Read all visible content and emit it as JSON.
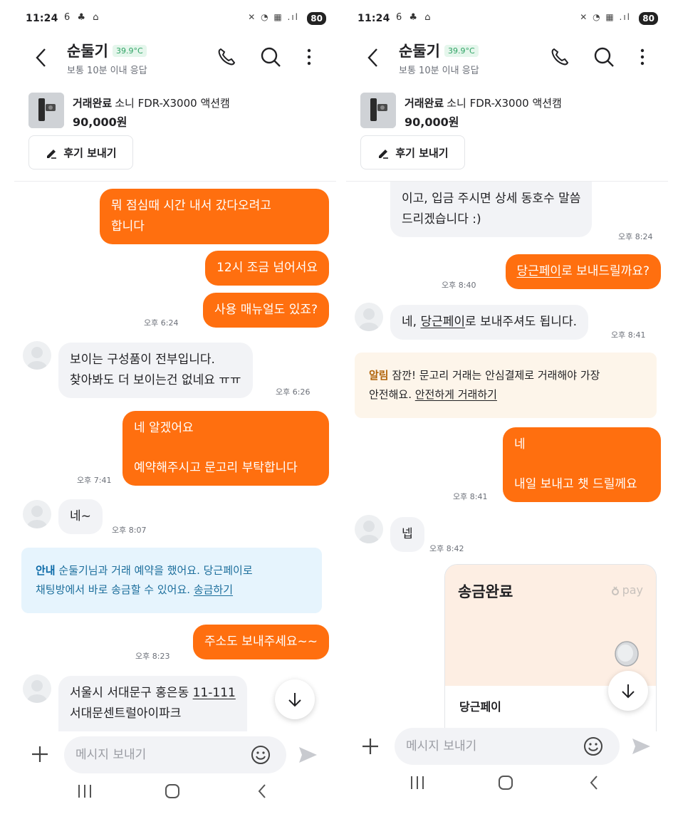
{
  "left": {
    "status": {
      "time": "11:24",
      "left_icons": "6 ♣ ⌂",
      "right_icons": "✕ ◔ ▦ .ıl",
      "battery": "80"
    },
    "header": {
      "name": "순둘기",
      "temp": "39.9°C",
      "subtitle": "보통 10분 이내 응답"
    },
    "product": {
      "status": "거래완료",
      "title": "소니 FDR-X3000 액션캠",
      "price": "90,000원"
    },
    "review_button": "후기 보내기",
    "messages": {
      "m1_l1": "뭐 점심때 시간 내서 갔다오려고",
      "m1_l2": "합니다",
      "m2": "12시 조금 넘어서요",
      "m3": "사용 매뉴얼도 있죠?",
      "t3": "오후 6:24",
      "m4_l1": "보이는 구성품이 전부입니다.",
      "m4_l2": "찾아봐도 더 보이는건 없네요 ㅠㅠ",
      "t4": "오후 6:26",
      "m5_l1": "네 알겠어요",
      "m5_l2": "예약해주시고 문고리 부탁합니다",
      "t5": "오후 7:41",
      "m6": "네~",
      "t6": "오후 8:07",
      "notice_label": "안내",
      "notice_text1": "순둘기님과 거래 예약을 했어요. 당근페이로",
      "notice_text2": "채팅방에서 바로 송금할 수 있어요.",
      "notice_link": "송금하기",
      "m7": "주소도 보내주세요~~",
      "t7": "오후 8:23",
      "m8_l1a": "서울시 서대문구 홍은동 ",
      "m8_l1b": "11-111",
      "m8_l2": "서대문센트럴아이파크"
    },
    "input": {
      "placeholder": "메시지 보내기"
    }
  },
  "right": {
    "status": {
      "time": "11:24",
      "left_icons": "6 ♣ ⌂",
      "right_icons": "✕ ◔ ▦ .ıl",
      "battery": "80"
    },
    "header": {
      "name": "순둘기",
      "temp": "39.9°C",
      "subtitle": "보통 10분 이내 응답"
    },
    "product": {
      "status": "거래완료",
      "title": "소니 FDR-X3000 액션캠",
      "price": "90,000원"
    },
    "review_button": "후기 보내기",
    "messages": {
      "r1_l1": "이고, 입금 주시면 상세 동호수 말씀",
      "r1_l2": "드리겠습니다 :)",
      "rt1": "오후 8:24",
      "r2_link": "당근페이",
      "r2_text": "로 보내드릴까요?",
      "rt2": "오후 8:40",
      "r3a": "네, ",
      "r3_link": "당근페이",
      "r3b": "로 보내주셔도 됩니다.",
      "rt3": "오후 8:41",
      "alert_label": "알림",
      "alert_text1": "잠깐! 문고리 거래는 안심결제로 거래해야 가장",
      "alert_text2": "안전해요.",
      "alert_link": "안전하게 거래하기",
      "r4_l1": "네",
      "r4_l2": "내일 보내고 챗 드릴께요",
      "rt4": "오후 8:41",
      "r5": "넵",
      "rt5": "오후 8:42",
      "pay_title": "송금완료",
      "pay_brand": "pay",
      "pay_footer": "당근페이"
    },
    "input": {
      "placeholder": "메시지 보내기"
    }
  },
  "colors": {
    "accent": "#ff6f0f",
    "bubble_in": "#f2f3f6",
    "notice_blue": "#e6f4fd",
    "notice_cream": "#fdf5ea",
    "temp_green": "#2ea364"
  },
  "icons": [
    "back-arrow-icon",
    "phone-icon",
    "search-icon",
    "more-vert-icon",
    "pencil-icon",
    "arrow-down-icon",
    "plus-icon",
    "emoji-icon",
    "send-icon",
    "recents-icon",
    "home-icon",
    "nav-back-icon"
  ]
}
